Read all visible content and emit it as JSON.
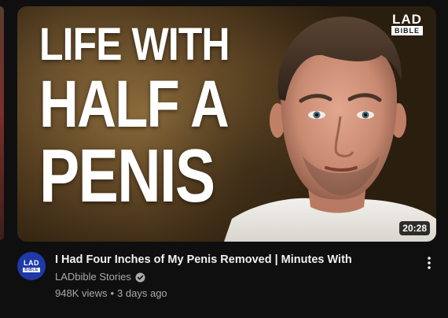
{
  "thumbnail": {
    "headline_line1": "LIFE WITH",
    "headline_line2": "HALF A",
    "headline_line3": "PENIS",
    "logo_top": "LAD",
    "logo_bottom": "BIBLE",
    "duration": "20:28"
  },
  "video": {
    "title": "I Had Four Inches of My Penis Removed | Minutes With",
    "channel": "LADbible Stories",
    "views": "948K views",
    "separator": "•",
    "age": "3 days ago"
  },
  "avatar": {
    "top": "LAD",
    "bottom": "BIBLE"
  },
  "icons": {
    "verified": "verified-check-icon",
    "menu": "more-vert-icon"
  },
  "colors": {
    "background": "#0f0f0f",
    "title": "#f1f1f1",
    "secondary_text": "#aaaaaa",
    "avatar_brand": "#1e3aa8"
  }
}
